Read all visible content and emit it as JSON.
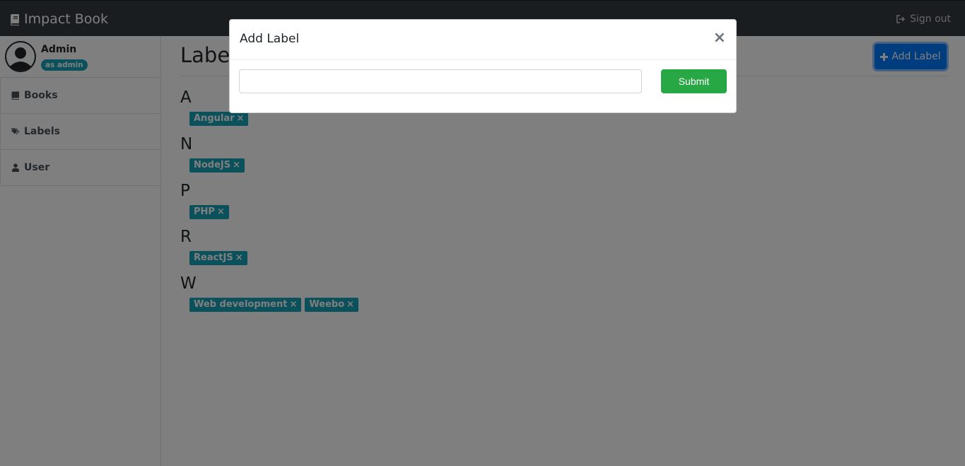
{
  "navbar": {
    "brand": "Impact Book",
    "brand_icon": "book-icon",
    "signout_label": "Sign out",
    "signout_icon": "sign-out-icon"
  },
  "sidebar": {
    "user_name": "Admin",
    "user_role": "as admin",
    "items": [
      {
        "label": "Books",
        "icon": "book-icon"
      },
      {
        "label": "Labels",
        "icon": "tags-icon"
      },
      {
        "label": "User",
        "icon": "user-icon"
      }
    ]
  },
  "main": {
    "title": "Labels",
    "add_button_label": "Add Label",
    "groups": [
      {
        "letter": "A",
        "labels": [
          "Angular"
        ]
      },
      {
        "letter": "N",
        "labels": [
          "NodeJS"
        ]
      },
      {
        "letter": "P",
        "labels": [
          "PHP"
        ]
      },
      {
        "letter": "R",
        "labels": [
          "ReactJS"
        ]
      },
      {
        "letter": "W",
        "labels": [
          "Web development",
          "Weebo"
        ]
      }
    ],
    "remove_glyph": "×"
  },
  "modal": {
    "title": "Add Label",
    "close_glyph": "×",
    "input_value": "",
    "input_placeholder": "",
    "submit_label": "Submit"
  },
  "colors": {
    "navbar": "#343a40",
    "primary": "#007bff",
    "success": "#28a745",
    "info": "#17a2b8"
  }
}
